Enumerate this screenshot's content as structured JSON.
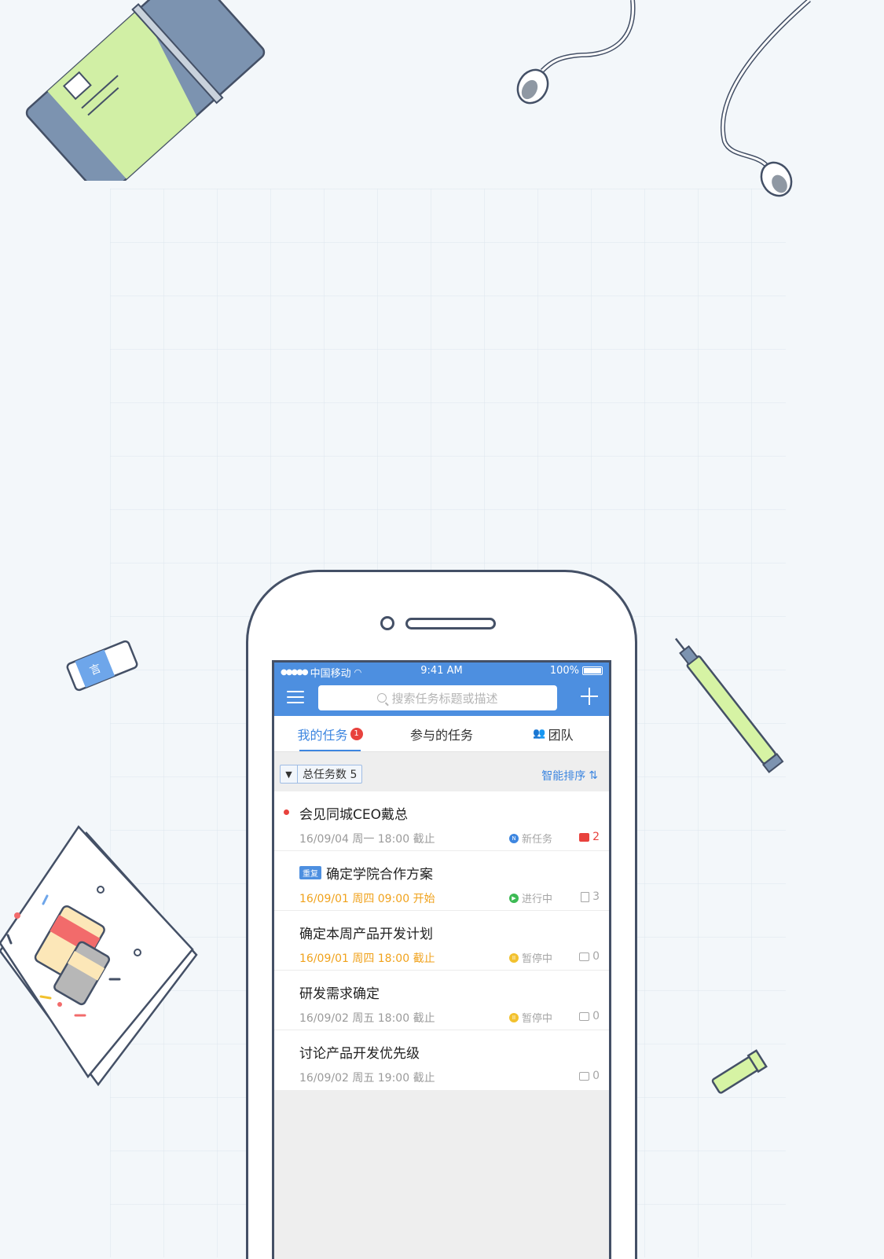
{
  "status_bar": {
    "signal": "●●●●●",
    "carrier": "中国移动",
    "time": "9:41 AM",
    "battery": "100%"
  },
  "navbar": {
    "search_placeholder": "搜索任务标题或描述",
    "menu_icon": "hamburger-icon",
    "add_icon": "plus-icon"
  },
  "tabs": [
    {
      "label": "我的任务",
      "badge": "1",
      "active": true
    },
    {
      "label": "参与的任务",
      "active": false
    },
    {
      "label": "团队",
      "active": false
    }
  ],
  "filter": {
    "label": "总任务数 5",
    "sort_label": "智能排序",
    "sort_icon": "⇅"
  },
  "tasks": [
    {
      "title": "会见同城CEO戴总",
      "urgent": true,
      "meta": "16/09/04 周一 18:00 截止",
      "meta_warn": false,
      "status": "新任务",
      "status_icon": "N",
      "count": "2",
      "count_icon": "comment-filled-icon"
    },
    {
      "title": "确定学院合作方案",
      "tag": "重复",
      "meta": "16/09/01 周四 09:00 开始",
      "meta_warn": true,
      "status": "进行中",
      "status_icon": "▶",
      "count": "3",
      "count_icon": "document-icon"
    },
    {
      "title": "确定本周产品开发计划",
      "meta": "16/09/01 周四 18:00 截止",
      "meta_warn": true,
      "status": "暂停中",
      "status_icon": "II",
      "count": "0",
      "count_icon": "comment-icon"
    },
    {
      "title": "研发需求确定",
      "meta": "16/09/02 周五 18:00 截止",
      "meta_warn": false,
      "status": "暂停中",
      "status_icon": "II",
      "count": "0",
      "count_icon": "comment-icon"
    },
    {
      "title": "讨论产品开发优先级",
      "meta": "16/09/02 周五 19:00 截止",
      "meta_warn": false,
      "status": "",
      "count": "0",
      "count_icon": "comment-icon"
    }
  ],
  "colors": {
    "brand": "#4d8fe0",
    "urgent": "#e8423d",
    "warning": "#f0a21c",
    "background": "#f3f7fa"
  }
}
